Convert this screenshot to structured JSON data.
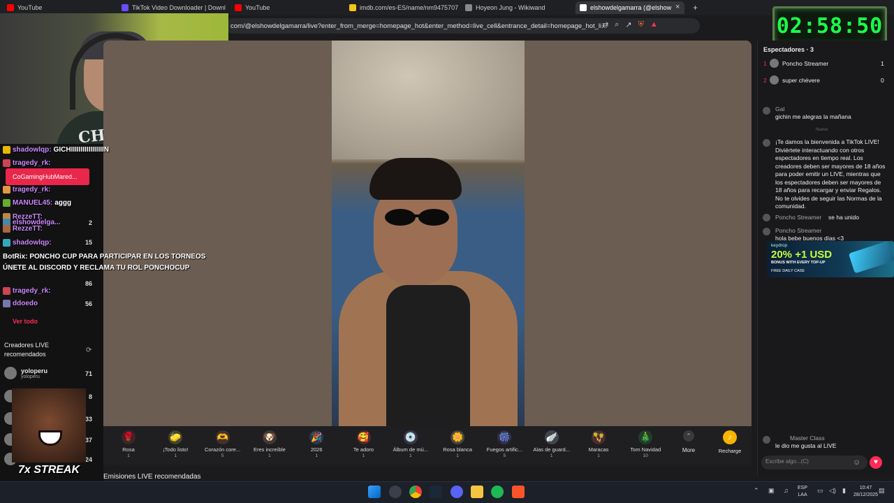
{
  "browser": {
    "tabs": [
      {
        "title": "YouTube",
        "color": "#ff0000"
      },
      {
        "title": "TikTok Video Downloader | Download",
        "color": "#6b4cff"
      },
      {
        "title": "YouTube",
        "color": "#ff0000"
      },
      {
        "title": "imdb.com/es-ES/name/nm9475707/",
        "color": "#f5c518"
      },
      {
        "title": "Hoyeon Jung - Wikiwand",
        "color": "#888888"
      },
      {
        "title": "elshowdelgamarra (@elshow",
        "color": "#ffffff",
        "active": true
      }
    ],
    "new_tab": "+",
    "close_tab": "×",
    "address": "com/@elshowdelgamarra/live?enter_from_merge=homepage_hot&enter_method=live_cell&entrance_detail=homepage_hot_li..."
  },
  "timer": "02:58:50",
  "webcam": {
    "shirt_text": "CHERRY"
  },
  "left_chat": {
    "lines": [
      {
        "user": "shadowlqp:",
        "msg": "GICHIIIIIIIIIIIIIIIIIN"
      },
      {
        "user": "tragedy_rk:",
        "msg": ""
      },
      {
        "user": "tragedy_rk:",
        "msg": ""
      },
      {
        "user": "MANUEL45:",
        "msg": "aggg"
      },
      {
        "user": "RezzeTT:",
        "msg": ""
      },
      {
        "user": "elshowdelga...",
        "msg": ""
      },
      {
        "user": "RezzeTT:",
        "msg": ""
      },
      {
        "user": "shadowlqp:",
        "msg": ""
      },
      {
        "user": "tragedy_rk:",
        "msg": ""
      },
      {
        "user": "ddoedo",
        "msg": ""
      }
    ],
    "pinned": "CoGamingHubMared...",
    "announcement_user": "BotRix:",
    "announcement": "PONCHO CUP PARA PARTICIPAR EN LOS TORNEOS ÚNETE AL DISCORD Y RECLAMA TU ROL PONCHOCUP",
    "viewer_counts": [
      "2",
      "15",
      "86",
      "56"
    ],
    "ver_todo": "Ver todo",
    "recommended_title": "Creadores LIVE recomendados",
    "recommended": [
      {
        "name": "yoloperu",
        "sub": "yoloperu",
        "count": "71"
      },
      {
        "name": "",
        "sub": "",
        "count": "8"
      },
      {
        "name": "",
        "sub": "",
        "count": "33"
      },
      {
        "name": "",
        "sub": "",
        "count": "37"
      },
      {
        "name": "",
        "sub": "",
        "count": "24"
      }
    ],
    "streak": "7x STREAK"
  },
  "gifts": [
    {
      "name": "Rosa",
      "price": "1",
      "icon": "🌹",
      "color": "#e8274a"
    },
    {
      "name": "¡Todo listo!",
      "price": "1",
      "icon": "🧽",
      "color": "#f2d43a"
    },
    {
      "name": "Corazón core...",
      "price": "5",
      "icon": "🫶",
      "color": "#e27b5a"
    },
    {
      "name": "Eres increíble",
      "price": "1",
      "icon": "🐶",
      "color": "#c9a27a"
    },
    {
      "name": "2026",
      "price": "1",
      "icon": "🎉",
      "color": "#4fa0ff"
    },
    {
      "name": "Te adoro",
      "price": "1",
      "icon": "🥰",
      "color": "#ff4f6a"
    },
    {
      "name": "Álbum de mú...",
      "price": "1",
      "icon": "💿",
      "color": "#c187ff"
    },
    {
      "name": "Rosa blanca",
      "price": "1",
      "icon": "🌼",
      "color": "#e8e8d0"
    },
    {
      "name": "Fuegos artific...",
      "price": "5",
      "icon": "🎆",
      "color": "#a46bff"
    },
    {
      "name": "Alas de guard...",
      "price": "1",
      "icon": "🪽",
      "color": "#c8e6ff"
    },
    {
      "name": "Maracas",
      "price": "1",
      "icon": "🪇",
      "color": "#ff6b4a"
    },
    {
      "name": "Tom Navidad",
      "price": "10",
      "icon": "🎄",
      "color": "#3ab54a"
    }
  ],
  "more_label": "More",
  "recharge_label": "Recharge",
  "emisiones_label": "Emisiones LIVE recomendadas",
  "right_panel": {
    "viewers_title": "Espectadores · 3",
    "viewers": [
      {
        "rank": "1",
        "name": "Poncho Streamer",
        "score": "1"
      },
      {
        "rank": "2",
        "name": "super chévere",
        "score": "0"
      }
    ],
    "comments": [
      {
        "user": "Gal",
        "text": "gichin me alegras la mañana"
      },
      {
        "user": "",
        "text": "¡Te damos la bienvenida a TikTok LIVE! Diviértete interactuando con otros espectadores en tiempo real. Los creadores deben ser mayores de 18 años para poder emitir un LIVE, mientras que los espectadores deben ser mayores de 18 años para recargar y enviar Regalos. No te olvides de seguir las Normas de la comunidad."
      },
      {
        "user": "Poncho Streamer",
        "text": "se ha unido"
      },
      {
        "user": "Poncho Streamer",
        "text": "hola bebe buenos días <3"
      },
      {
        "user": "Master Class",
        "text": "le dio me gusta al LIVE"
      }
    ],
    "nuevo_label": "Nuevo",
    "ad": {
      "brand": "keydrop",
      "headline": "20% +1 USD",
      "sub": "BONUS WITH EVERY TOP-UP",
      "tag": "FREE DAILY CASE"
    },
    "input_placeholder": "Escribe algo...(C)"
  },
  "taskbar": {
    "lang": "ESP",
    "lang2": "LAA",
    "time": "10:47",
    "date": "28/12/2025"
  }
}
